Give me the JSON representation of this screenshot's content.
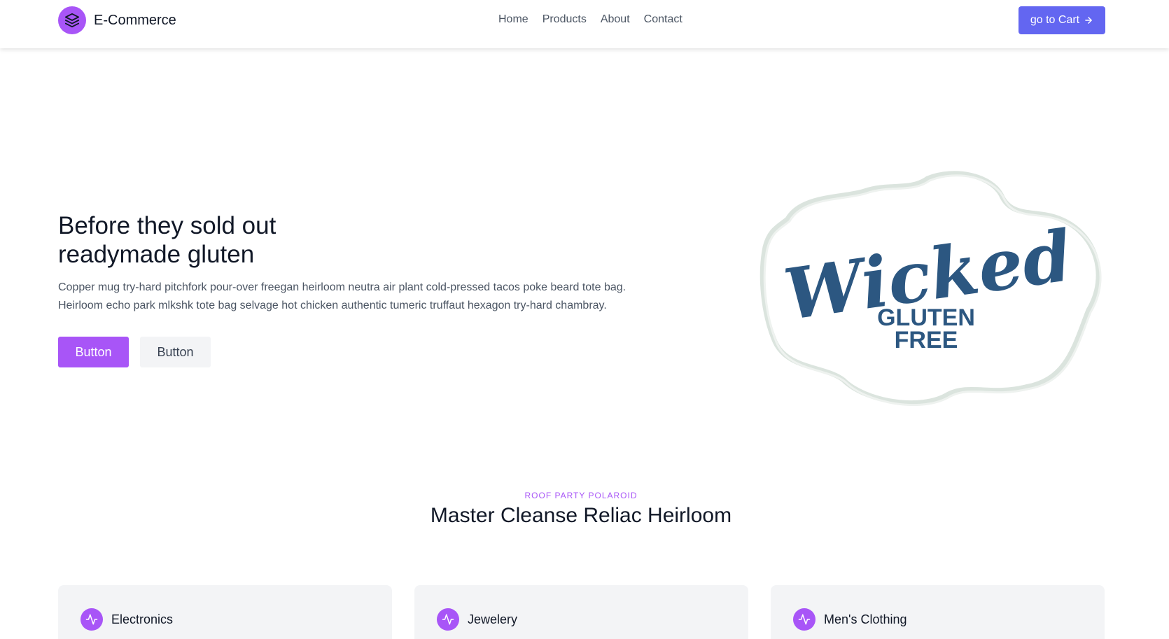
{
  "brand": {
    "name": "E-Commerce",
    "logo_icon": "layers-icon",
    "accent": "#a855f7"
  },
  "nav": {
    "items": [
      {
        "label": "Home"
      },
      {
        "label": "Products"
      },
      {
        "label": "About"
      },
      {
        "label": "Contact"
      }
    ]
  },
  "header": {
    "cart_label": "go to Cart",
    "cart_icon": "arrow-right-icon",
    "cart_color": "#6366f1"
  },
  "hero": {
    "title_line1": "Before they sold out",
    "title_line2": "readymade gluten",
    "text": "Copper mug try-hard pitchfork pour-over freegan heirloom neutra air plant cold-pressed tacos poke beard tote bag. Heirloom echo park mlkshk tote bag selvage hot chicken authentic tumeric truffaut hexagon try-hard chambray.",
    "primary_label": "Button",
    "secondary_label": "Button",
    "image": {
      "script_text": "Wicked",
      "line1": "GLUTEN",
      "line2": "FREE",
      "ink_color": "#2c5781"
    }
  },
  "features": {
    "eyebrow": "ROOF PARTY POLAROID",
    "title": "Master Cleanse Reliac Heirloom",
    "cards": [
      {
        "title": "Electronics",
        "icon": "activity-icon"
      },
      {
        "title": "Jewelery",
        "icon": "activity-icon"
      },
      {
        "title": "Men's Clothing",
        "icon": "activity-icon"
      }
    ]
  }
}
